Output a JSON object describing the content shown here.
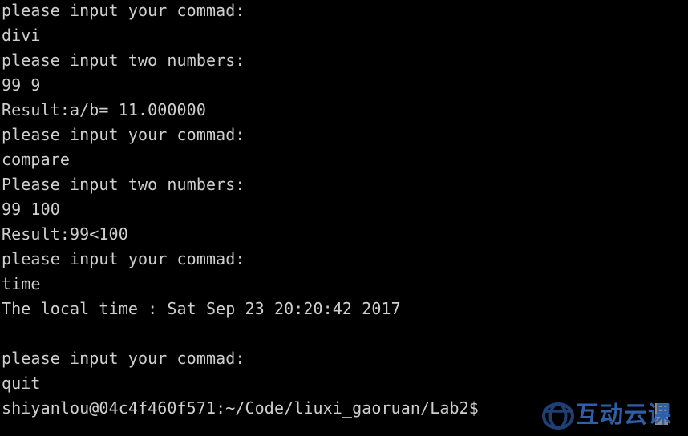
{
  "terminal": {
    "background_color": "#000000",
    "text_color": "#cfcfcf",
    "cursor_color": "#8d8d8d",
    "lines": [
      "please input your commad:",
      "divi",
      "please input two numbers:",
      "99 9",
      "Result:a/b= 11.000000",
      "please input your commad:",
      "compare",
      "Please input two numbers:",
      "99 100",
      "Result:99<100",
      "please input your commad:",
      "time",
      "The local time : Sat Sep 23 20:20:42 2017",
      "",
      "please input your commad:",
      "quit"
    ],
    "prompt": {
      "user": "shiyanlou",
      "host": "04c4f460f571",
      "separator": "@",
      "colon": ":",
      "path": "~/Code/liuxi_gaoruan/Lab2",
      "symbol": "$",
      "full": "shiyanlou@04c4f460f571:~/Code/liuxi_gaoruan/Lab2$ "
    }
  },
  "watermark": {
    "text": "互动云课",
    "color": "#2f5fa6",
    "logo_name": "oval-logo"
  }
}
